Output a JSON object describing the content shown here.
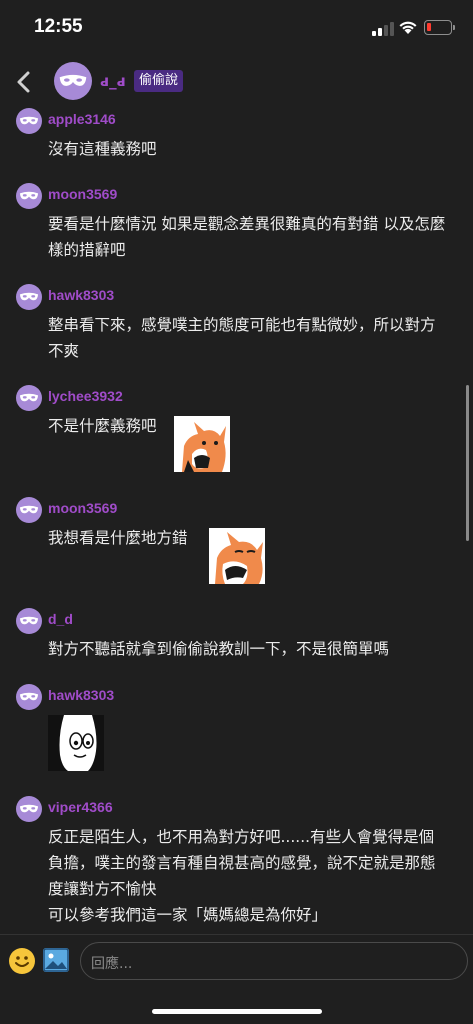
{
  "status_bar": {
    "time": "12:55"
  },
  "header": {
    "name": "ԁ_ԁ",
    "badge": "偷偷說"
  },
  "messages": [
    {
      "user": "apple3146",
      "text": "沒有這種義務吧"
    },
    {
      "user": "moon3569",
      "text": "要看是什麼情況 如果是觀念差異很難真的有對錯 以及怎麼樣的措辭吧"
    },
    {
      "user": "hawk8303",
      "text": "整串看下來，感覺噗主的態度可能也有點微妙，所以對方不爽"
    },
    {
      "user": "lychee3932",
      "text": "不是什麼義務吧"
    },
    {
      "user": "moon3569",
      "text": "我想看是什麼地方錯"
    },
    {
      "user": "ԁ_ԁ",
      "text": "對方不聽話就拿到偷偷說教訓一下，不是很簡單嗎"
    },
    {
      "user": "hawk8303",
      "text": ""
    },
    {
      "user": "viper4366",
      "text": "反正是陌生人，也不用為對方好吧......有些人會覺得是個負擔，噗主的發言有種自視甚高的感覺，說不定就是那態度讓對方不愉快\n可以參考我們這一家「媽媽總是為你好」"
    }
  ],
  "composer": {
    "placeholder": "回應..."
  },
  "icons": {
    "back": "chevron-left-icon",
    "avatar": "mask-icon",
    "emoji": "smiley-icon",
    "image": "image-icon"
  },
  "colors": {
    "background": "#1f1f1f",
    "username": "#a04cc9",
    "avatar": "#a78ad7",
    "badge": "#4a2b82"
  }
}
